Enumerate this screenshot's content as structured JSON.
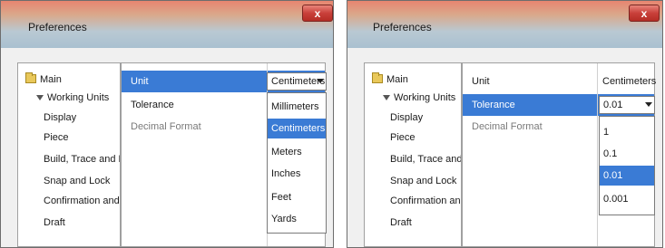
{
  "windows": [
    {
      "title": "Preferences",
      "close_label": "x",
      "tree": [
        {
          "label": "Main",
          "icon": "folder-icon"
        },
        {
          "label": "Working Units",
          "icon": "expand-triangle-icon"
        },
        {
          "label": "Display"
        },
        {
          "label": "Piece"
        },
        {
          "label": "Build, Trace and M"
        },
        {
          "label": "Snap and Lock"
        },
        {
          "label": "Confirmation and A"
        },
        {
          "label": "Draft"
        }
      ],
      "properties": [
        {
          "label": "Unit"
        },
        {
          "label": "Tolerance"
        },
        {
          "label": "Decimal Format"
        }
      ],
      "combo": {
        "value": "Centimeters"
      },
      "options": [
        "Millimeters",
        "Centimeters",
        "Meters",
        "Inches",
        "Feet",
        "Yards"
      ],
      "highlighted_option": "Centimeters"
    },
    {
      "title": "Preferences",
      "close_label": "x",
      "tree": [
        {
          "label": "Main",
          "icon": "folder-icon"
        },
        {
          "label": "Working Units",
          "icon": "expand-triangle-icon"
        },
        {
          "label": "Display"
        },
        {
          "label": "Piece"
        },
        {
          "label": "Build, Trace and M"
        },
        {
          "label": "Snap and Lock"
        },
        {
          "label": "Confirmation and A"
        },
        {
          "label": "Draft"
        }
      ],
      "properties": [
        {
          "label": "Unit"
        },
        {
          "label": "Tolerance"
        },
        {
          "label": "Decimal Format"
        }
      ],
      "unit_value": "Centimeters",
      "combo": {
        "value": "0.01"
      },
      "options": [
        "1",
        "0.1",
        "0.01",
        "0.001"
      ],
      "highlighted_option": "0.01"
    }
  ],
  "colors": {
    "selection": "#3a7bd5",
    "close_button": "#c9403a"
  }
}
